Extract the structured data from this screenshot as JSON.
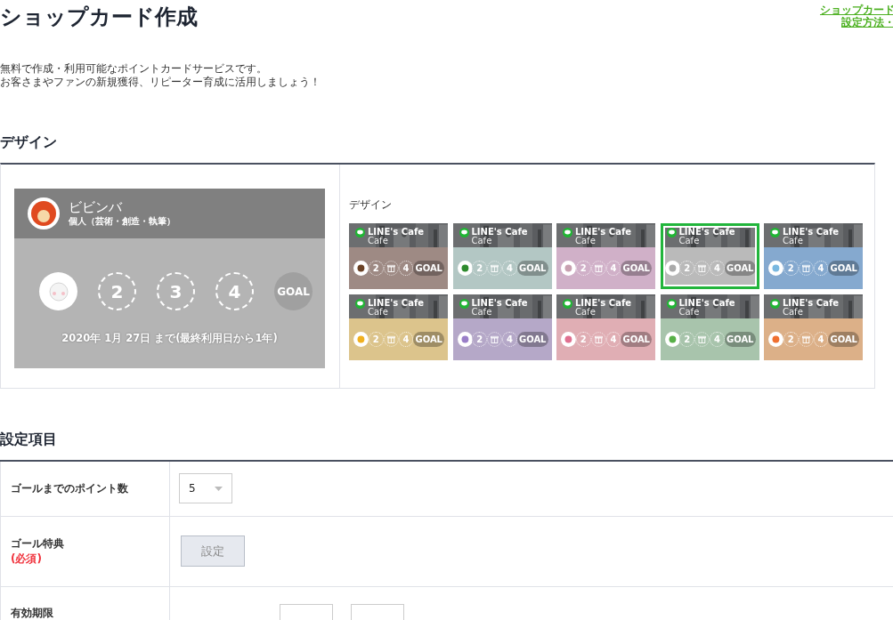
{
  "page": {
    "title": "ショップカード作成",
    "help_link": [
      "ショップカード",
      "設定方法・"
    ],
    "intro": [
      "無料で作成・利用可能なポイントカードサービスです。",
      "お客さまやファンの新規獲得、リピーター育成に活用しましょう！"
    ]
  },
  "design": {
    "heading": "デザイン",
    "preview": {
      "shop_name": "ビビンバ",
      "category": "個人（芸術・創造・執筆）",
      "stamps": [
        {
          "kind": "stamped"
        },
        {
          "kind": "number",
          "label": "2"
        },
        {
          "kind": "number",
          "label": "3"
        },
        {
          "kind": "number",
          "label": "4"
        },
        {
          "kind": "goal",
          "label": "GOAL"
        }
      ],
      "expiry": "2020年 1月 27日 まで(最終利用日から1年)"
    },
    "picker_label": "デザイン",
    "themes": [
      {
        "title": "LINE's Cafe",
        "subtitle": "Cafe",
        "steps": [
          "2",
          "4"
        ],
        "goal": "GOAL",
        "color": "#9e8a84",
        "selected": false
      },
      {
        "title": "LINE's Cafe",
        "subtitle": "Cafe",
        "steps": [
          "2",
          "4"
        ],
        "goal": "GOAL",
        "color": "#b3c7c4",
        "selected": false
      },
      {
        "title": "LINE's Cafe",
        "subtitle": "Cafe",
        "steps": [
          "2",
          "4"
        ],
        "goal": "GOAL",
        "color": "#d0b0c8",
        "selected": false
      },
      {
        "title": "LINE's Cafe",
        "subtitle": "Cafe",
        "steps": [
          "2",
          "4"
        ],
        "goal": "GOAL",
        "color": "#bababa",
        "selected": true
      },
      {
        "title": "LINE's Cafe",
        "subtitle": "Cafe",
        "steps": [
          "2",
          "4"
        ],
        "goal": "GOAL",
        "color": "#85a9cf",
        "selected": false
      },
      {
        "title": "LINE's Cafe",
        "subtitle": "Cafe",
        "steps": [
          "2",
          "4"
        ],
        "goal": "GOAL",
        "color": "#dcc48c",
        "selected": false
      },
      {
        "title": "LINE's Cafe",
        "subtitle": "Cafe",
        "steps": [
          "2",
          "4"
        ],
        "goal": "GOAL",
        "color": "#b5a8c8",
        "selected": false
      },
      {
        "title": "LINE's Cafe",
        "subtitle": "Cafe",
        "steps": [
          "2",
          "4"
        ],
        "goal": "GOAL",
        "color": "#e0aeb4",
        "selected": false
      },
      {
        "title": "LINE's Cafe",
        "subtitle": "Cafe",
        "steps": [
          "2",
          "4"
        ],
        "goal": "GOAL",
        "color": "#a8c4ac",
        "selected": false
      },
      {
        "title": "LINE's Cafe",
        "subtitle": "Cafe",
        "steps": [
          "2",
          "4"
        ],
        "goal": "GOAL",
        "color": "#dcb088",
        "selected": false
      }
    ]
  },
  "settings": {
    "heading": "設定項目",
    "rows": [
      {
        "kind": "select",
        "label": "ゴールまでのポイント数",
        "value": "5"
      },
      {
        "kind": "button",
        "label": "ゴール特典",
        "required": "(必須)",
        "button": "設定"
      },
      {
        "kind": "inputs",
        "label": "有効期限"
      }
    ]
  }
}
